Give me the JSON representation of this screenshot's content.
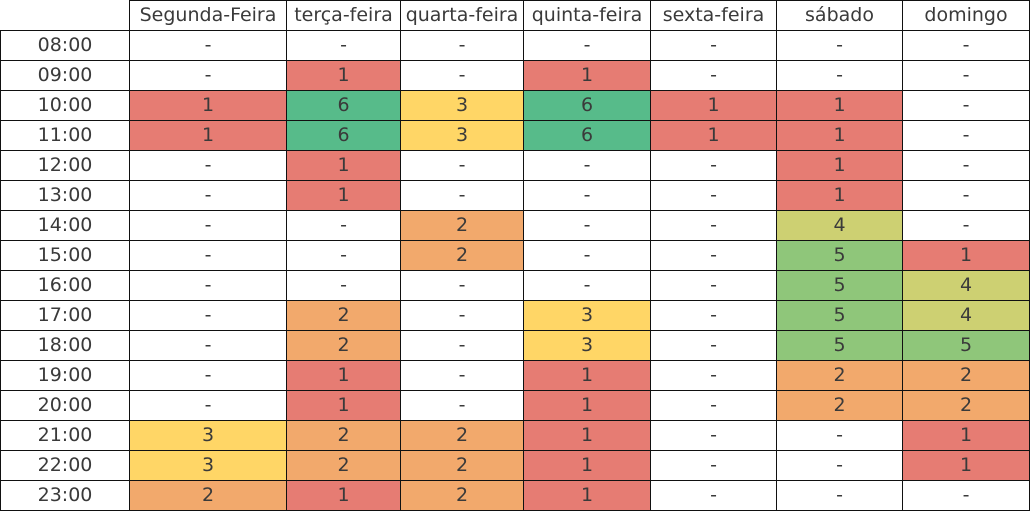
{
  "table": {
    "columns": [
      "Segunda-Feira",
      "terça-feira",
      "quarta-feira",
      "quinta-feira",
      "sexta-feira",
      "sábado",
      "domingo"
    ],
    "rows": [
      {
        "time": "08:00",
        "cells": [
          "-",
          "-",
          "-",
          "-",
          "-",
          "-",
          "-"
        ]
      },
      {
        "time": "09:00",
        "cells": [
          "-",
          "1",
          "-",
          "1",
          "-",
          "-",
          "-"
        ]
      },
      {
        "time": "10:00",
        "cells": [
          "1",
          "6",
          "3",
          "6",
          "1",
          "1",
          "-"
        ]
      },
      {
        "time": "11:00",
        "cells": [
          "1",
          "6",
          "3",
          "6",
          "1",
          "1",
          "-"
        ]
      },
      {
        "time": "12:00",
        "cells": [
          "-",
          "1",
          "-",
          "-",
          "-",
          "1",
          "-"
        ]
      },
      {
        "time": "13:00",
        "cells": [
          "-",
          "1",
          "-",
          "-",
          "-",
          "1",
          "-"
        ]
      },
      {
        "time": "14:00",
        "cells": [
          "-",
          "-",
          "2",
          "-",
          "-",
          "4",
          "-"
        ]
      },
      {
        "time": "15:00",
        "cells": [
          "-",
          "-",
          "2",
          "-",
          "-",
          "5",
          "1"
        ]
      },
      {
        "time": "16:00",
        "cells": [
          "-",
          "-",
          "-",
          "-",
          "-",
          "5",
          "4"
        ]
      },
      {
        "time": "17:00",
        "cells": [
          "-",
          "2",
          "-",
          "3",
          "-",
          "5",
          "4"
        ]
      },
      {
        "time": "18:00",
        "cells": [
          "-",
          "2",
          "-",
          "3",
          "-",
          "5",
          "5"
        ]
      },
      {
        "time": "19:00",
        "cells": [
          "-",
          "1",
          "-",
          "1",
          "-",
          "2",
          "2"
        ]
      },
      {
        "time": "20:00",
        "cells": [
          "-",
          "1",
          "-",
          "1",
          "-",
          "2",
          "2"
        ]
      },
      {
        "time": "21:00",
        "cells": [
          "3",
          "2",
          "2",
          "1",
          "-",
          "-",
          "1"
        ]
      },
      {
        "time": "22:00",
        "cells": [
          "3",
          "2",
          "2",
          "1",
          "-",
          "-",
          "1"
        ]
      },
      {
        "time": "23:00",
        "cells": [
          "2",
          "1",
          "2",
          "1",
          "-",
          "-",
          "-"
        ]
      }
    ]
  },
  "colors": {
    "1": "#e67c73",
    "2": "#f2a96c",
    "3": "#ffd666",
    "4": "#cdd072",
    "5": "#8fc67a",
    "6": "#57bb8a",
    "empty": "#ffffff",
    "text": "#3a3a3a",
    "border": "#111111"
  }
}
